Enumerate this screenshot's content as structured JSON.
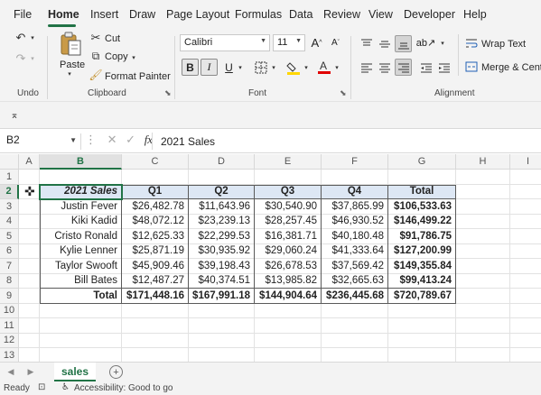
{
  "menu": {
    "tabs": [
      "File",
      "Home",
      "Insert",
      "Draw",
      "Page Layout",
      "Formulas",
      "Data",
      "Review",
      "View",
      "Developer",
      "Help"
    ],
    "active": "Home"
  },
  "ribbon": {
    "undo_group": "Undo",
    "clipboard": {
      "group": "Clipboard",
      "paste": "Paste",
      "cut": "Cut",
      "copy": "Copy",
      "format_painter": "Format Painter"
    },
    "font": {
      "group": "Font",
      "name": "Calibri",
      "size": "11",
      "bold": "B",
      "italic": "I",
      "underline": "U",
      "grow": "A",
      "shrink": "A"
    },
    "alignment": {
      "group": "Alignment",
      "wrap_text": "Wrap Text",
      "merge_center": "Merge & Cente"
    }
  },
  "formula_bar": {
    "name_box": "B2",
    "fx": "fx",
    "content": "2021 Sales"
  },
  "sheet": {
    "columns": [
      "A",
      "B",
      "C",
      "D",
      "E",
      "F",
      "G",
      "H",
      "I"
    ],
    "rows": [
      "1",
      "2",
      "3",
      "4",
      "5",
      "6",
      "7",
      "8",
      "9",
      "10",
      "11",
      "12",
      "13"
    ],
    "table": {
      "corner": "2021 Sales",
      "headers": [
        "Q1",
        "Q2",
        "Q3",
        "Q4",
        "Total"
      ],
      "rows": [
        {
          "name": "Justin Fever",
          "values": [
            "$26,482.78",
            "$11,643.96",
            "$30,540.90",
            "$37,865.99",
            "$106,533.63"
          ]
        },
        {
          "name": "Kiki Kadid",
          "values": [
            "$48,072.12",
            "$23,239.13",
            "$28,257.45",
            "$46,930.52",
            "$146,499.22"
          ]
        },
        {
          "name": "Cristo Ronald",
          "values": [
            "$12,625.33",
            "$22,299.53",
            "$16,381.71",
            "$40,180.48",
            "$91,786.75"
          ]
        },
        {
          "name": "Kylie Lenner",
          "values": [
            "$25,871.19",
            "$30,935.92",
            "$29,060.24",
            "$41,333.64",
            "$127,200.99"
          ]
        },
        {
          "name": "Taylor Swooft",
          "values": [
            "$45,909.46",
            "$39,198.43",
            "$26,678.53",
            "$37,569.42",
            "$149,355.84"
          ]
        },
        {
          "name": "Bill Bates",
          "values": [
            "$12,487.27",
            "$40,374.51",
            "$13,985.82",
            "$32,665.63",
            "$99,413.24"
          ]
        }
      ],
      "total_row": {
        "name": "Total",
        "values": [
          "$171,448.16",
          "$167,991.18",
          "$144,904.64",
          "$236,445.68",
          "$720,789.67"
        ]
      }
    }
  },
  "sheets": {
    "active": "sales",
    "add": "+"
  },
  "status": {
    "ready": "Ready",
    "accessibility": "Accessibility: Good to go"
  },
  "colors": {
    "accent": "#217346",
    "header_fill": "#dde7f4"
  }
}
